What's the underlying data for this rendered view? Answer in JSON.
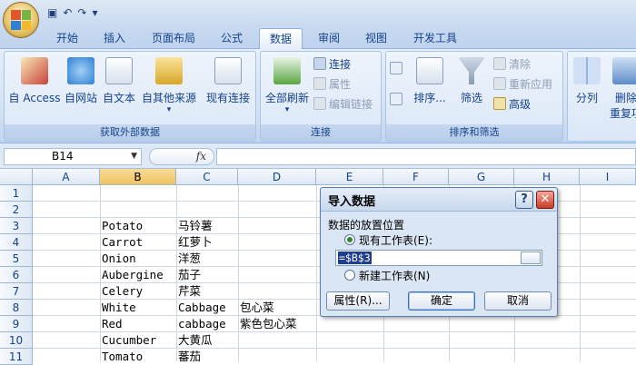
{
  "tabs": [
    "开始",
    "插入",
    "页面布局",
    "公式",
    "数据",
    "审阅",
    "视图",
    "开发工具"
  ],
  "active_tab": "数据",
  "ribbon": {
    "groups": [
      {
        "label": "获取外部数据",
        "buttons": [
          "自 Access",
          "自网站",
          "自文本",
          "自其他来源",
          "现有连接"
        ]
      },
      {
        "label": "连接",
        "big": "全部刷新",
        "items": [
          "连接",
          "属性",
          "编辑链接"
        ]
      },
      {
        "label": "排序和筛选",
        "items": [
          "排序...",
          "筛选",
          "清除",
          "重新应用",
          "高级"
        ]
      },
      {
        "label": "",
        "items": [
          "分列",
          "删除",
          "重复项"
        ]
      }
    ]
  },
  "formula": {
    "namebox": "B14",
    "fx": "fx"
  },
  "columns": [
    "A",
    "B",
    "C",
    "D",
    "E",
    "F",
    "G",
    "H",
    "I"
  ],
  "rows": [
    "1",
    "2",
    "3",
    "4",
    "5",
    "6",
    "7",
    "8",
    "9",
    "10",
    "11"
  ],
  "cells": {
    "r4": {
      "B": "Potato",
      "C": "马铃薯"
    },
    "r5": {
      "B": "Carrot",
      "C": "红萝卜"
    },
    "r6": {
      "B": "Onion",
      "C": "洋葱"
    },
    "r7": {
      "B": "Aubergine",
      "C": "茄子"
    },
    "r8": {
      "B": "Celery",
      "C": "芹菜"
    },
    "r9": {
      "B": "White",
      "C": "Cabbage",
      "D": "包心菜"
    },
    "r10": {
      "B": "Red",
      "C": "cabbage",
      "D": "紫色包心菜"
    },
    "r11": {
      "B": "Cucumber",
      "C": "大黄瓜"
    },
    "r12": {
      "B": "Tomato",
      "C": "蕃茄"
    }
  },
  "dialog": {
    "title": "导入数据",
    "help": "?",
    "close": "✕",
    "section": "数据的放置位置",
    "opt_existing": "现有工作表(E):",
    "range_value": "=$B$3",
    "opt_new": "新建工作表(N)",
    "btn_props": "属性(R)...",
    "btn_ok": "确定",
    "btn_cancel": "取消"
  },
  "colors": {
    "accent": "#15428b",
    "ribbon": "#dbe7f7",
    "selected_header": "#f1c15f"
  }
}
